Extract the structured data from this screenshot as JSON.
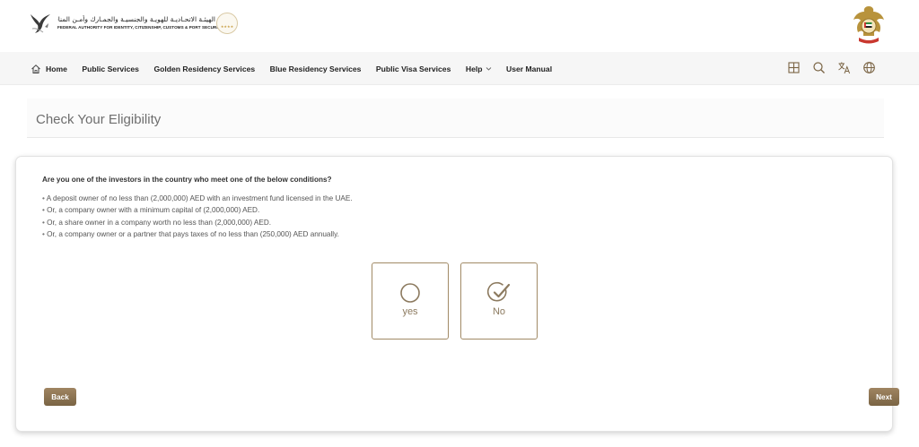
{
  "header": {
    "logo_text_ar": "الهيئـة الاتحـاديـة للهويـة والجنسيـة والجمـارك وأمـن المنافـذ",
    "logo_text_en": "FEDERAL AUTHORITY FOR IDENTITY, CITIZENSHIP, CUSTOMS & PORT SECURITY",
    "badge_stars": "★★★★"
  },
  "nav": {
    "items": [
      {
        "label": "Home",
        "icon": "home-icon"
      },
      {
        "label": "Public Services"
      },
      {
        "label": "Golden Residency Services"
      },
      {
        "label": "Blue Residency Services"
      },
      {
        "label": "Public Visa Services"
      },
      {
        "label": "Help",
        "icon": "chevron-down-icon"
      },
      {
        "label": "User Manual"
      }
    ],
    "icons": [
      "grid-icon",
      "search-icon",
      "translate-icon",
      "globe-icon"
    ]
  },
  "page": {
    "title": "Check Your Eligibility"
  },
  "form": {
    "question": "Are you one of the investors in the country who meet one of the below conditions?",
    "conditions": [
      "A deposit owner of no less than (2,000,000) AED with an investment fund licensed in the UAE.",
      "Or, a company owner with a minimum capital of (2,000,000) AED.",
      "Or, a share owner in a company worth no less than (2,000,000) AED.",
      "Or, a company owner or a partner that pays taxes of no less than (250,000) AED annually."
    ],
    "options": {
      "yes": "yes",
      "no": "No"
    },
    "selected": "No",
    "back_label": "Back",
    "next_label": "Next"
  },
  "colors": {
    "accent": "#8c7a5f",
    "button": "#8a7352",
    "border": "#a18a66"
  }
}
